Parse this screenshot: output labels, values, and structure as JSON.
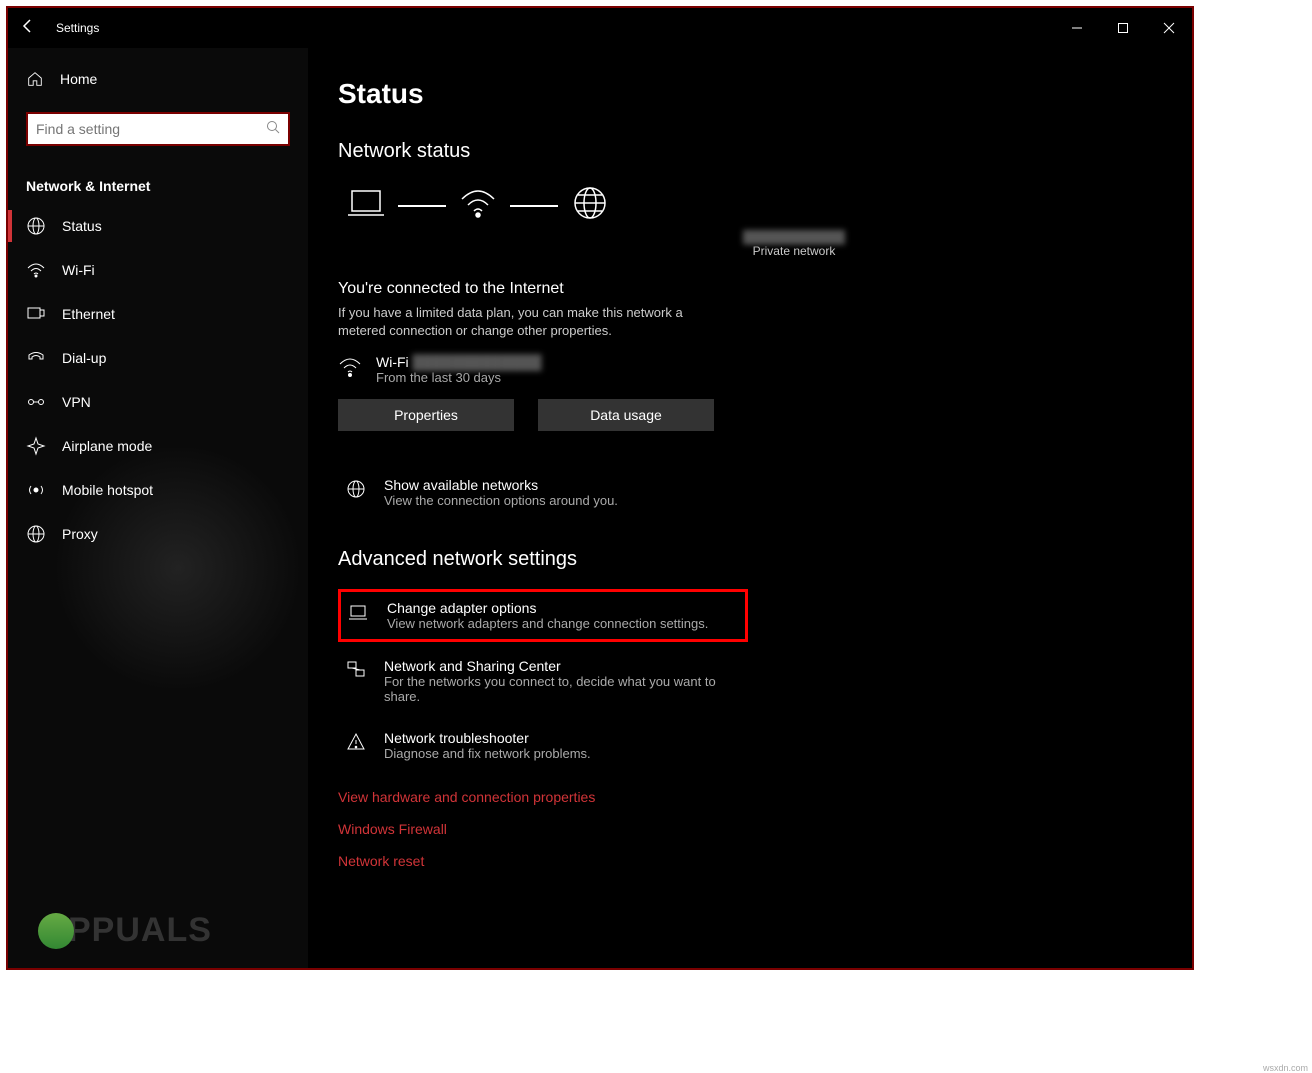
{
  "titlebar": {
    "title": "Settings"
  },
  "sidebar": {
    "home": "Home",
    "search_placeholder": "Find a setting",
    "category": "Network & Internet",
    "items": [
      {
        "label": "Status"
      },
      {
        "label": "Wi-Fi"
      },
      {
        "label": "Ethernet"
      },
      {
        "label": "Dial-up"
      },
      {
        "label": "VPN"
      },
      {
        "label": "Airplane mode"
      },
      {
        "label": "Mobile hotspot"
      },
      {
        "label": "Proxy"
      }
    ]
  },
  "main": {
    "page_title": "Status",
    "section1": "Network status",
    "diagram_caption": "Private network",
    "connected_heading": "You're connected to the Internet",
    "connected_text": "If you have a limited data plan, you can make this network a metered connection or change other properties.",
    "conn_name": "Wi-Fi",
    "conn_sub": "From the last 30 days",
    "btn_props": "Properties",
    "btn_usage": "Data usage",
    "show_networks_title": "Show available networks",
    "show_networks_sub": "View the connection options around you.",
    "section2": "Advanced network settings",
    "adapter_title": "Change adapter options",
    "adapter_sub": "View network adapters and change connection settings.",
    "sharing_title": "Network and Sharing Center",
    "sharing_sub": "For the networks you connect to, decide what you want to share.",
    "trouble_title": "Network troubleshooter",
    "trouble_sub": "Diagnose and fix network problems.",
    "link1": "View hardware and connection properties",
    "link2": "Windows Firewall",
    "link3": "Network reset"
  },
  "branding": {
    "logo": "PPUALS",
    "watermark": "wsxdn.com"
  }
}
